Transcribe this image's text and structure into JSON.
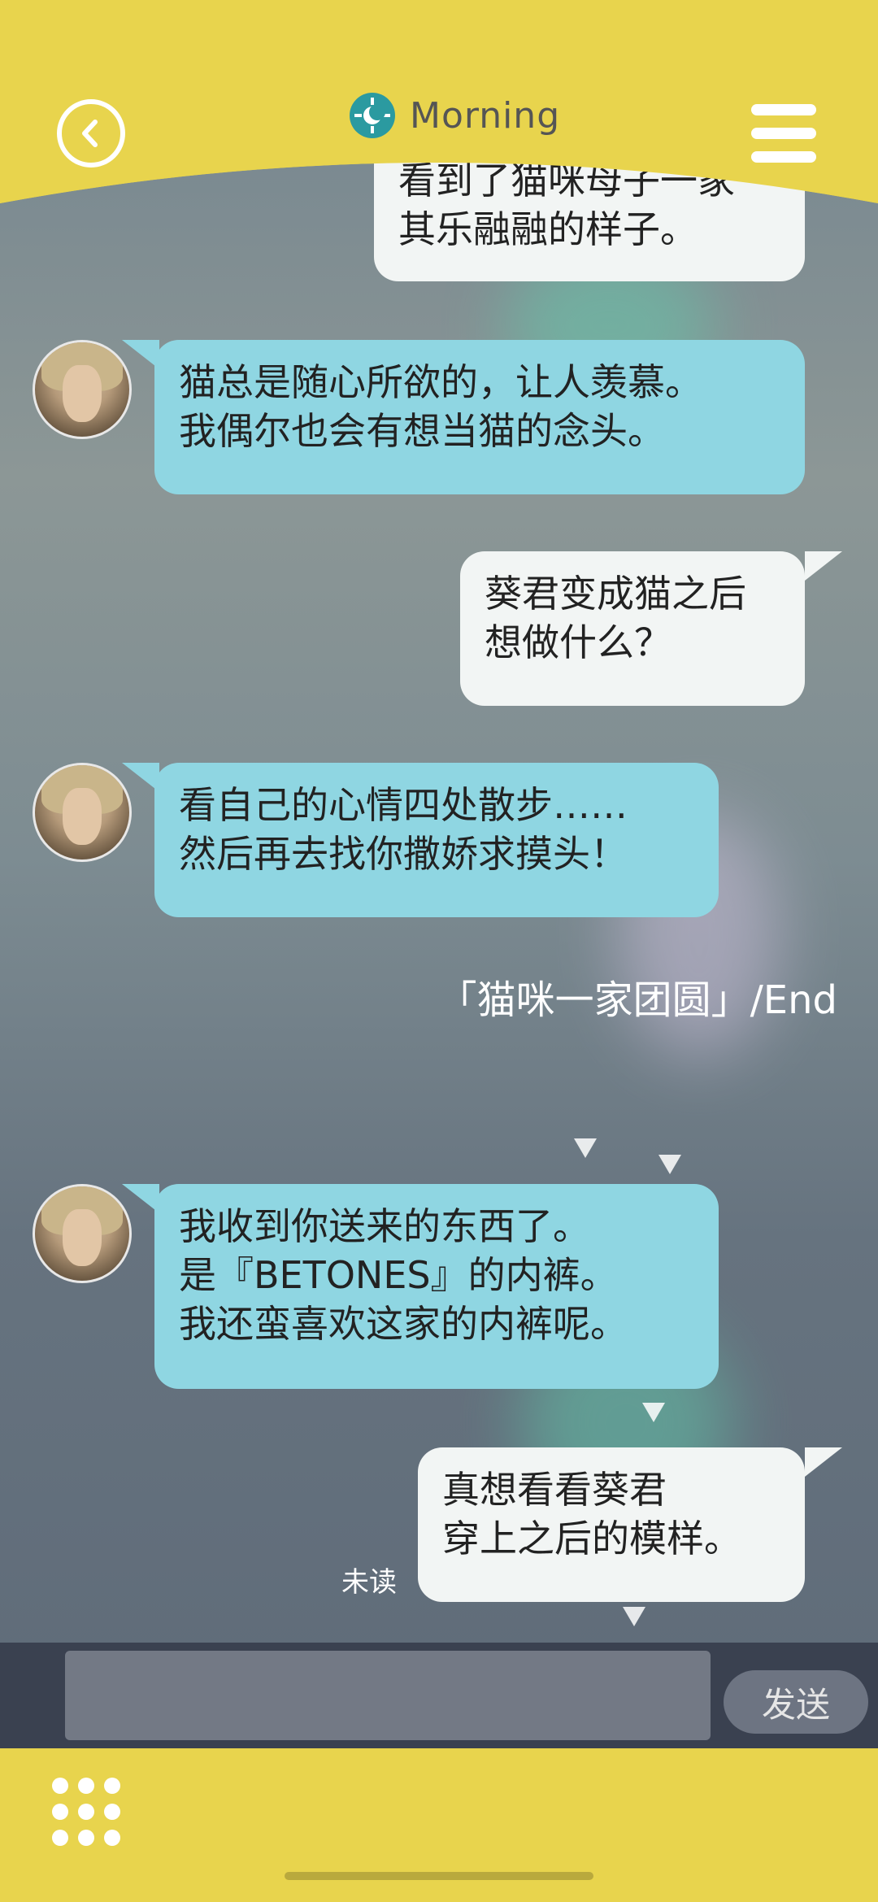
{
  "header": {
    "title": "Morning",
    "back_icon": "chevron-left-icon",
    "menu_icon": "hamburger-menu-icon",
    "time_icon": "morning-sun-icon"
  },
  "colors": {
    "header_yellow": "#e8d44d",
    "bubble_left": "#8fd6e2",
    "bubble_right": "#f2f5f4",
    "input_bar": "#3a4150"
  },
  "messages": [
    {
      "side": "right",
      "lines": [
        "看到了猫咪母子一家",
        "其乐融融的样子。"
      ]
    },
    {
      "side": "left",
      "lines": [
        "猫总是随心所欲的，让人羡慕。",
        "我偶尔也会有想当猫的念头。"
      ]
    },
    {
      "side": "right",
      "lines": [
        "葵君变成猫之后",
        "想做什么？"
      ]
    },
    {
      "side": "left",
      "lines": [
        "看自己的心情四处散步……",
        "然后再去找你撒娇求摸头！"
      ]
    },
    {
      "side": "left",
      "lines": [
        "我收到你送来的东西了。",
        "是『BETONES』的内裤。",
        "我还蛮喜欢这家的内裤呢。"
      ]
    },
    {
      "side": "right",
      "lines": [
        "真想看看葵君",
        "穿上之后的模样。"
      ]
    }
  ],
  "system_text": "「猫咪一家团圆」/End",
  "unread_label": "未读",
  "input": {
    "placeholder": "",
    "value": ""
  },
  "send_label": "发送",
  "footer": {
    "grid_icon": "grid-menu-icon"
  }
}
